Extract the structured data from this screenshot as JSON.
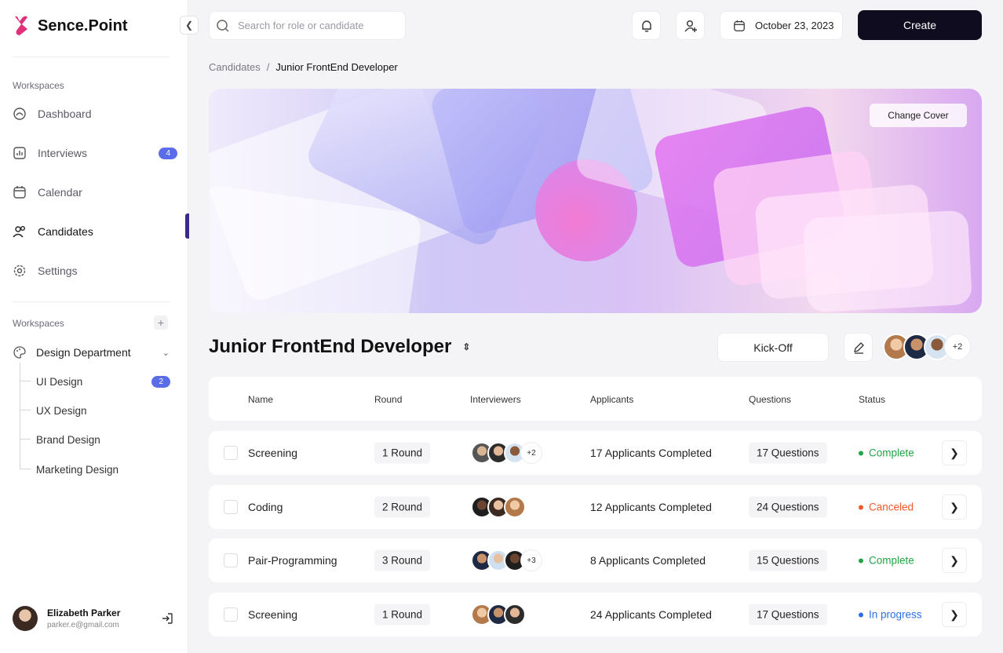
{
  "brand": {
    "name": "Sence.Point",
    "accent": "#e0307a"
  },
  "sidebar": {
    "section1_label": "Workspaces",
    "nav": [
      {
        "label": "Dashboard",
        "icon": "dashboard-icon"
      },
      {
        "label": "Interviews",
        "icon": "interviews-icon",
        "badge": "4"
      },
      {
        "label": "Calendar",
        "icon": "calendar-icon"
      },
      {
        "label": "Candidates",
        "icon": "candidates-icon"
      },
      {
        "label": "Settings",
        "icon": "settings-icon"
      }
    ],
    "active": "Candidates",
    "section2_label": "Workspaces",
    "department": "Design Department",
    "sub_items": [
      {
        "label": "UI Design",
        "badge": "2"
      },
      {
        "label": "UX Design"
      },
      {
        "label": "Brand Design"
      },
      {
        "label": "Marketing Design"
      }
    ],
    "user": {
      "name": "Elizabeth Parker",
      "email": "parker.e@gmail.com"
    }
  },
  "topbar": {
    "search_placeholder": "Search for role or candidate",
    "date": "October 23, 2023",
    "create_label": "Create"
  },
  "breadcrumb": {
    "parent": "Candidates",
    "separator": "/",
    "current": "Junior FrontEnd Developer"
  },
  "cover": {
    "change_label": "Change Cover"
  },
  "job": {
    "title": "Junior FrontEnd Developer",
    "kickoff_label": "Kick-Off",
    "team_more": "+2"
  },
  "table": {
    "headers": {
      "name": "Name",
      "round": "Round",
      "interviewers": "Interviewers",
      "applicants": "Applicants",
      "questions": "Questions",
      "status": "Status"
    },
    "rows": [
      {
        "name": "Screening",
        "round": "1 Round",
        "interviewers_more": "+2",
        "applicants": "17 Applicants Completed",
        "questions": "17 Questions",
        "status": "Complete",
        "status_color": "#22a447"
      },
      {
        "name": "Coding",
        "round": "2  Round",
        "interviewers_more": "",
        "applicants": "12 Applicants Completed",
        "questions": "24 Questions",
        "status": "Canceled",
        "status_color": "#f05a28"
      },
      {
        "name": "Pair-Programming",
        "round": "3 Round",
        "interviewers_more": "+3",
        "applicants": "8 Applicants Completed",
        "questions": "15 Questions",
        "status": "Complete",
        "status_color": "#22a447"
      },
      {
        "name": "Screening",
        "round": "1 Round",
        "interviewers_more": "",
        "applicants": "24 Applicants Completed",
        "questions": "17 Questions",
        "status": "In progress",
        "status_color": "#2b6ee6"
      }
    ]
  }
}
